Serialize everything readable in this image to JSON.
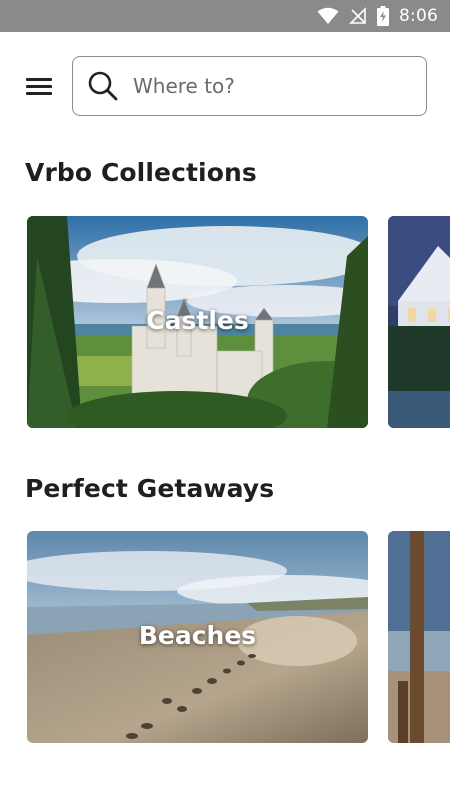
{
  "status_bar": {
    "time": "8:06"
  },
  "search": {
    "placeholder": "Where to?"
  },
  "sections": [
    {
      "title": "Vrbo Collections",
      "cards": [
        {
          "label": "Castles"
        }
      ]
    },
    {
      "title": "Perfect Getaways",
      "cards": [
        {
          "label": "Beaches"
        }
      ]
    }
  ],
  "icons": {
    "menu": "hamburger-menu-icon",
    "search": "magnifier-icon",
    "wifi": "wifi-icon",
    "signal": "signal-off-icon",
    "battery": "battery-charging-icon"
  },
  "colors": {
    "status_bar": "#8a8a8a",
    "text": "#1f1f1f",
    "border": "#8c8c8c"
  }
}
